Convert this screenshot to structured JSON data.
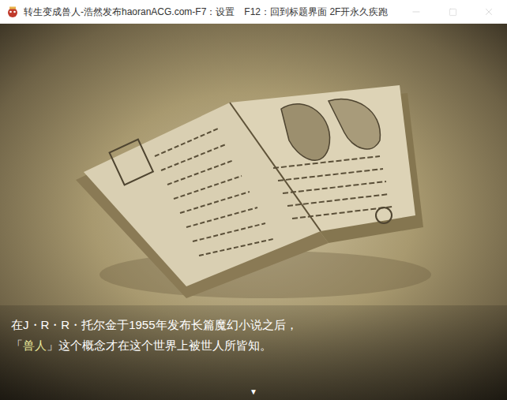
{
  "window": {
    "title": "转生变成兽人-浩然发布haoranACG.com-F7：设置　F12：回到标题界面 2F开永久疾跑",
    "controls": [
      {
        "kind": "minimize",
        "disabled": true
      },
      {
        "kind": "maximize",
        "disabled": true
      },
      {
        "kind": "close",
        "disabled": true
      }
    ]
  },
  "message": {
    "lines": [
      [
        {
          "text": "在J・R・R・托尔金于1955年发布长篇魔幻小说之后，",
          "highlight": false
        }
      ],
      [
        {
          "text": "「",
          "highlight": false
        },
        {
          "text": "兽人",
          "highlight": true
        },
        {
          "text": "」这个概念才在这个世界上被世人所皆知。",
          "highlight": false
        }
      ]
    ],
    "indicator": "▼"
  }
}
